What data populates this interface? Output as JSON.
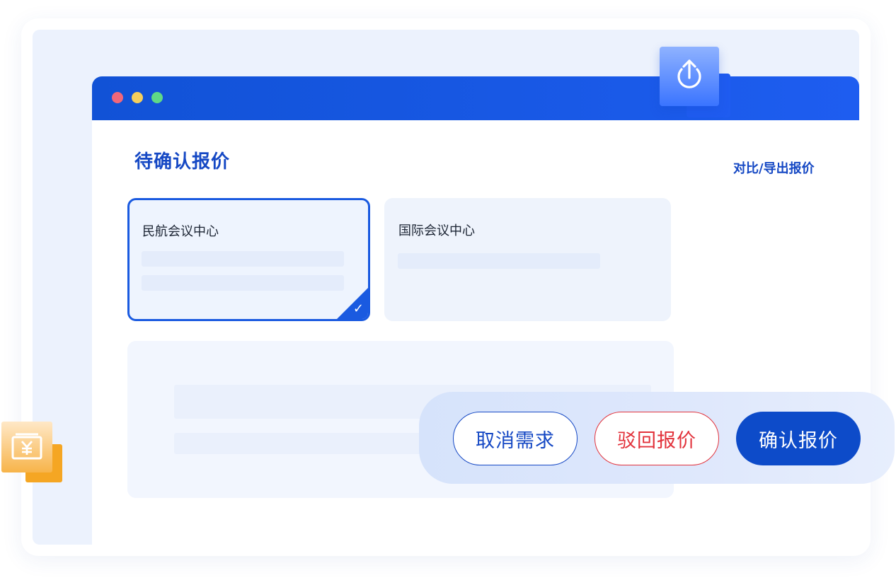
{
  "window": {
    "controls": [
      "close-dot",
      "minimize-dot",
      "maximize-dot"
    ]
  },
  "main": {
    "title": "待确认报价",
    "export_link": "对比/导出报价",
    "venues": [
      {
        "name": "民航会议中心",
        "selected": true
      },
      {
        "name": "国际会议中心",
        "selected": false
      }
    ]
  },
  "actions": {
    "cancel_label": "取消需求",
    "reject_label": "驳回报价",
    "confirm_label": "确认报价"
  },
  "icons": {
    "upload": "upload-icon",
    "money": "yuan-money-icon",
    "check": "check-icon"
  },
  "colors": {
    "brand_blue": "#1548c4",
    "titlebar_blue": "#1e5df0",
    "reject_red": "#e2323b",
    "confirm_blue": "#0d4bc9",
    "accent_orange": "#f5a623"
  }
}
